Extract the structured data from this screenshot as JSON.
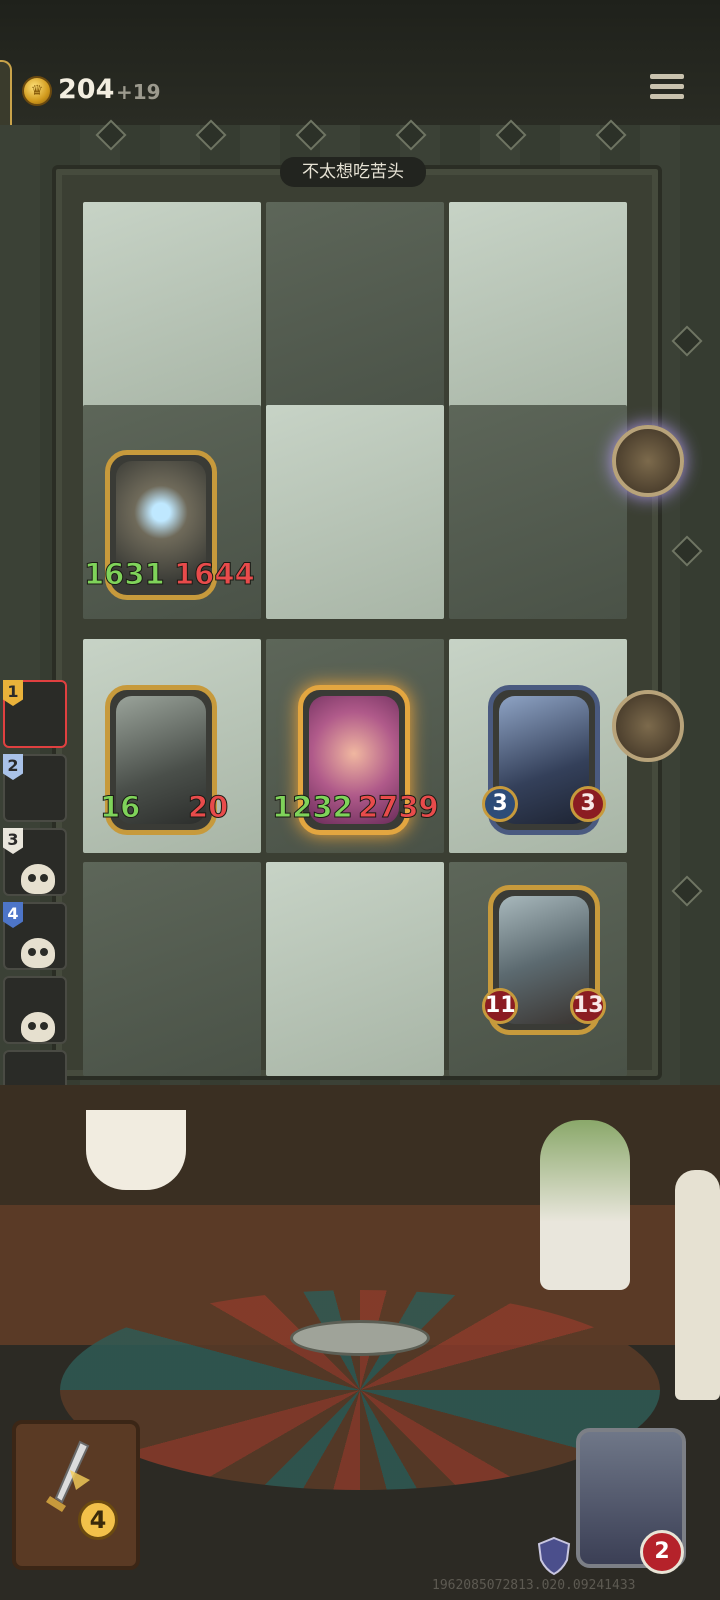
{
  "header": {
    "coins": "204",
    "coin_income": "+19"
  },
  "board": {
    "title": "不太想吃苦头"
  },
  "cards": {
    "horned_dragon_skull": {
      "attack": "1631",
      "health": "1644"
    },
    "dark_dragon": {
      "attack": "16",
      "health": "20"
    },
    "goggles_dwarf": {
      "attack": "1232",
      "health": "2739"
    },
    "panther": {
      "attack": "3",
      "health": "3"
    },
    "furry_beast": {
      "attack": "11",
      "health": "13"
    }
  },
  "queue": {
    "slots": [
      {
        "number": "1"
      },
      {
        "number": "2"
      },
      {
        "number": "3"
      },
      {
        "number": "4"
      }
    ]
  },
  "bottom": {
    "sword_count": "4",
    "hero_hp": "2",
    "build_id": "1962085072813.020.09241433"
  },
  "colors": {
    "gold": "#c79a3c",
    "attack": "#7fd35a",
    "health": "#e84b4b"
  }
}
